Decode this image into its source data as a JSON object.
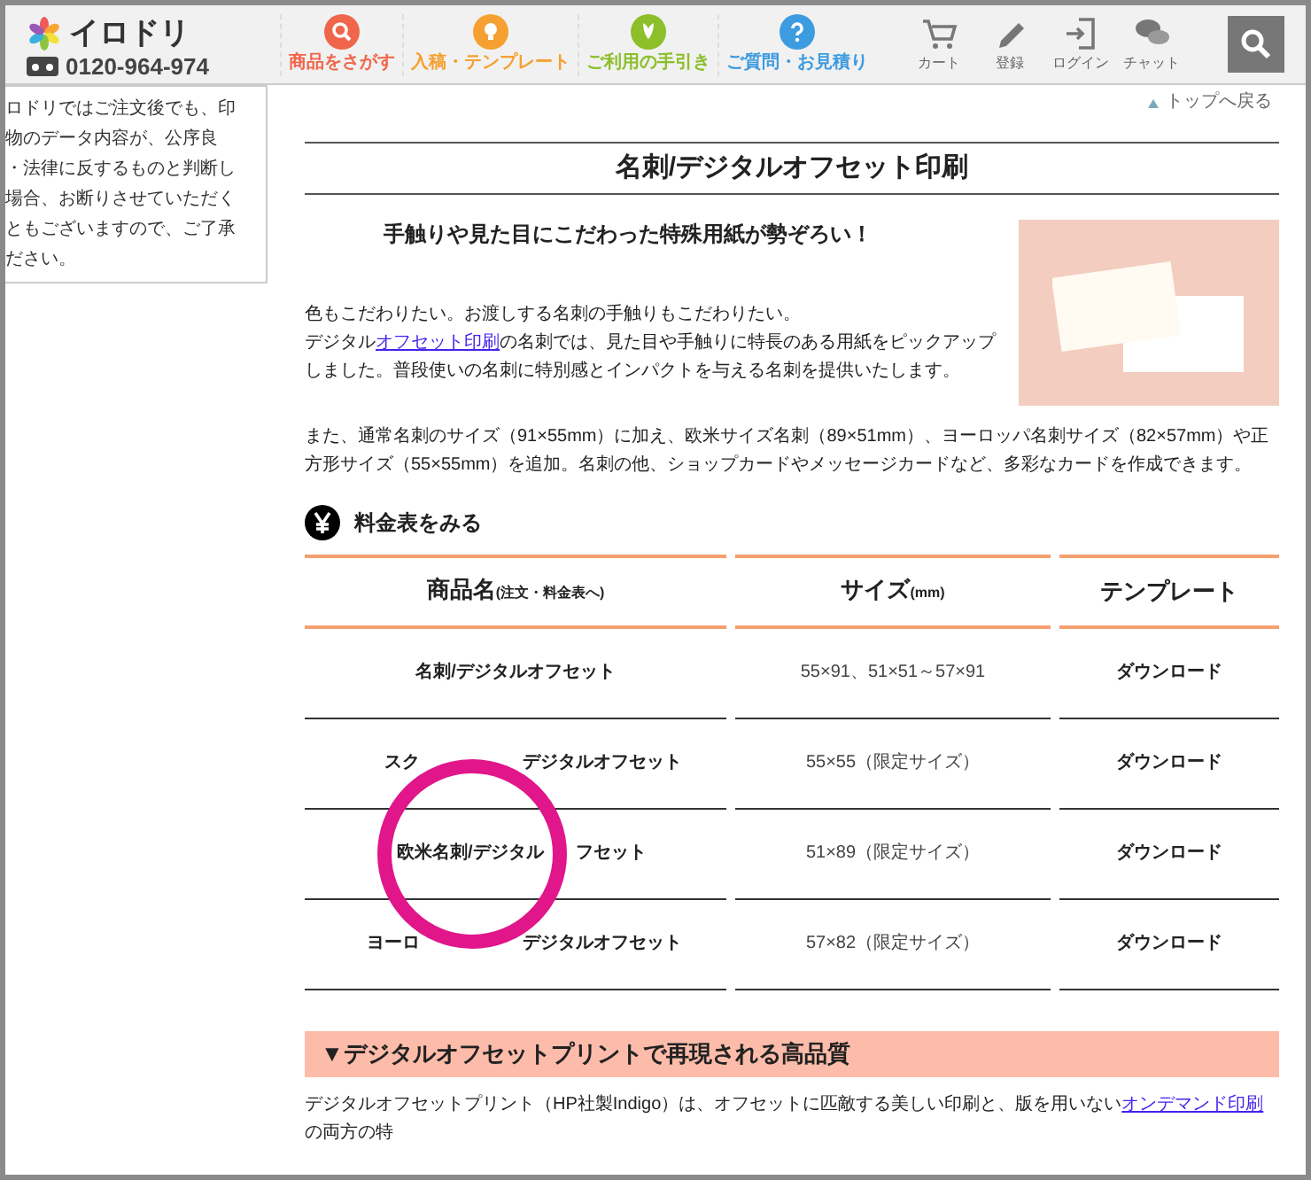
{
  "header": {
    "logo": "イロドリ",
    "phone": "0120-964-974",
    "nav": [
      {
        "label": "商品をさがす",
        "kind": "search",
        "color": "#f0664a"
      },
      {
        "label": "入稿・テンプレート",
        "kind": "bulb",
        "color": "#f5a030"
      },
      {
        "label": "ご利用の手引き",
        "kind": "leaf",
        "color": "#8cbf2a"
      },
      {
        "label": "ご質問・お見積り",
        "kind": "question",
        "color": "#3d9be0"
      }
    ],
    "tools": [
      {
        "label": "カート",
        "kind": "cart"
      },
      {
        "label": "登録",
        "kind": "pencil"
      },
      {
        "label": "ログイン",
        "kind": "login"
      },
      {
        "label": "チャット",
        "kind": "chat"
      }
    ]
  },
  "side_note": [
    "ロドリではご注文後でも、印",
    "物のデータ内容が、公序良",
    "・法律に反するものと判断し",
    "場合、お断りさせていただく",
    "ともございますので、ご了承",
    "ださい。"
  ],
  "back_to_top": "トップへ戻る",
  "title": "名刺/デジタルオフセット印刷",
  "catch": "手触りや見た目にこだわった特殊用紙が勢ぞろい！",
  "intro": [
    {
      "before": "色もこだわりたい。お渡しする名刺の手触りもこだわりたい。"
    },
    {
      "before": "デジタル",
      "link": "オフセット印刷",
      "after": "の名刺では、見た目や手触りに特長のある用紙をピックアップしました。普段使いの名刺に特別感とインパクトを与える名刺を提供いたします。"
    }
  ],
  "intro2": "また、通常名刺のサイズ（91×55mm）に加え、欧米サイズ名刺（89×51mm）、ヨーロッパ名刺サイズ（82×57mm）や正方形サイズ（55×55mm）を追加。名刺の他、ショップカードやメッセージカードなど、多彩なカードを作成できます。",
  "price_heading": "料金表をみる",
  "table": {
    "columns": [
      {
        "main": "商品名",
        "sub": "(注文・料金表へ)"
      },
      {
        "main": "サイズ",
        "sub": "(mm)"
      },
      {
        "main": "テンプレート"
      }
    ],
    "rows": [
      {
        "name_parts": [
          "名刺/デジタルオフセット"
        ],
        "size": "55×91、51×51～57×91",
        "template": "ダウンロード"
      },
      {
        "name_parts": [
          "スク",
          "デジタルオフセット"
        ],
        "size": "55×55（限定サイズ）",
        "template": "ダウンロード"
      },
      {
        "name_parts": [
          "欧米名刺/デジタル",
          "フセット"
        ],
        "size": "51×89（限定サイズ）",
        "template": "ダウンロード"
      },
      {
        "name_parts": [
          "ヨーロ",
          "デジタルオフセット"
        ],
        "size": "57×82（限定サイズ）",
        "template": "ダウンロード"
      }
    ]
  },
  "section_heading": "▼デジタルオフセットプリントで再現される高品質",
  "section_text": {
    "before": "デジタルオフセットプリント（HP社製Indigo）は、オフセットに匹敵する美しい印刷と、版を用いない",
    "link": "オンデマンド印刷",
    "after": "の両方の特"
  }
}
